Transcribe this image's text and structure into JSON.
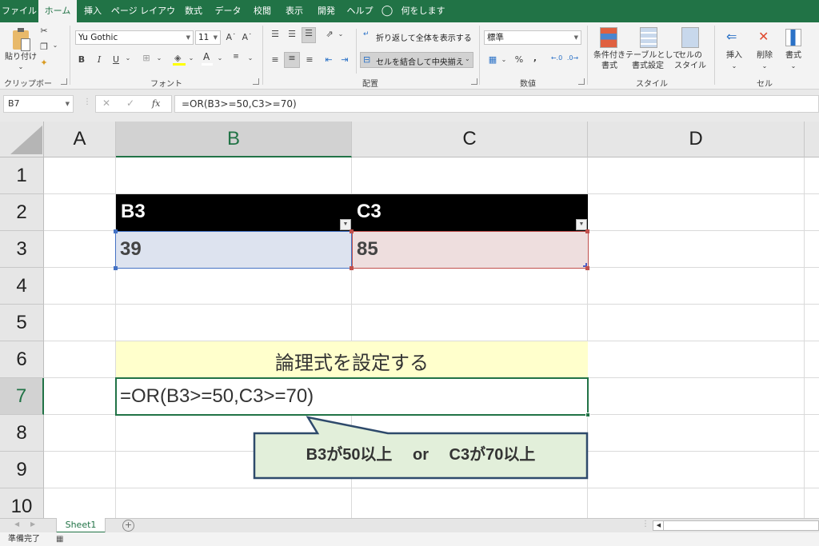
{
  "menu": {
    "tabs": [
      {
        "label": "ファイル",
        "active": false
      },
      {
        "label": "ホーム",
        "active": true
      },
      {
        "label": "挿入",
        "active": false
      },
      {
        "label": "ページ レイアウト",
        "active": false
      },
      {
        "label": "数式",
        "active": false
      },
      {
        "label": "データ",
        "active": false
      },
      {
        "label": "校閲",
        "active": false
      },
      {
        "label": "表示",
        "active": false
      },
      {
        "label": "開発",
        "active": false
      },
      {
        "label": "ヘルプ",
        "active": false
      }
    ],
    "tell_me": "何をしますか"
  },
  "ribbon": {
    "clipboard": {
      "paste_label": "貼り付け",
      "group_label": "クリップボード"
    },
    "font": {
      "font_name": "Yu Gothic",
      "font_size": "11",
      "group_label": "フォント",
      "bold": "B",
      "italic": "I",
      "underline": "U",
      "font_color_glyph": "A"
    },
    "alignment": {
      "wrap_text": "折り返して全体を表示する",
      "merge_center": "セルを結合して中央揃え",
      "group_label": "配置"
    },
    "number": {
      "format": "標準",
      "percent": "%",
      "comma": ",",
      "group_label": "数値"
    },
    "styles": {
      "conditional_line1": "条件付き",
      "conditional_line2": "書式",
      "table_line1": "テーブルとして",
      "table_line2": "書式設定",
      "cell_styles_line1": "セルの",
      "cell_styles_line2": "スタイル",
      "group_label": "スタイル"
    },
    "cells": {
      "insert": "挿入",
      "delete": "削除",
      "format": "書式",
      "group_label": "セル"
    }
  },
  "formula_bar": {
    "name_box": "B7",
    "cancel_glyph": "✕",
    "enter_glyph": "✓",
    "fx_label": "fx",
    "formula": "=OR(B3>=50,C3>=70)"
  },
  "grid": {
    "columns": [
      "A",
      "B",
      "C",
      "D"
    ],
    "selected_column": "B",
    "rows": [
      "1",
      "2",
      "3",
      "4",
      "5",
      "6",
      "7",
      "8",
      "9",
      "10"
    ],
    "selected_row": "7",
    "cells": {
      "B2": "B3",
      "C2": "C3",
      "B3": "39",
      "C3": "85",
      "B6": "論理式を設定する",
      "B7": "=OR(B3>=50,C3>=70)"
    },
    "colors": {
      "header_fill": "#000000",
      "b3_fill": "#dde3ef",
      "b3_border": "#4472c4",
      "c3_fill": "#eedede",
      "c3_border": "#c0504d",
      "b6_fill": "#ffffcc",
      "selection_border": "#217346"
    }
  },
  "callout": {
    "text": "B3が50以上　 or　 C3が70以上",
    "fill": "#e2efda",
    "border": "#2e4a6b"
  },
  "sheet_tabs": {
    "tabs": [
      "Sheet1"
    ],
    "active": "Sheet1",
    "add_glyph": "+"
  },
  "status_bar": {
    "status": "準備完了"
  }
}
